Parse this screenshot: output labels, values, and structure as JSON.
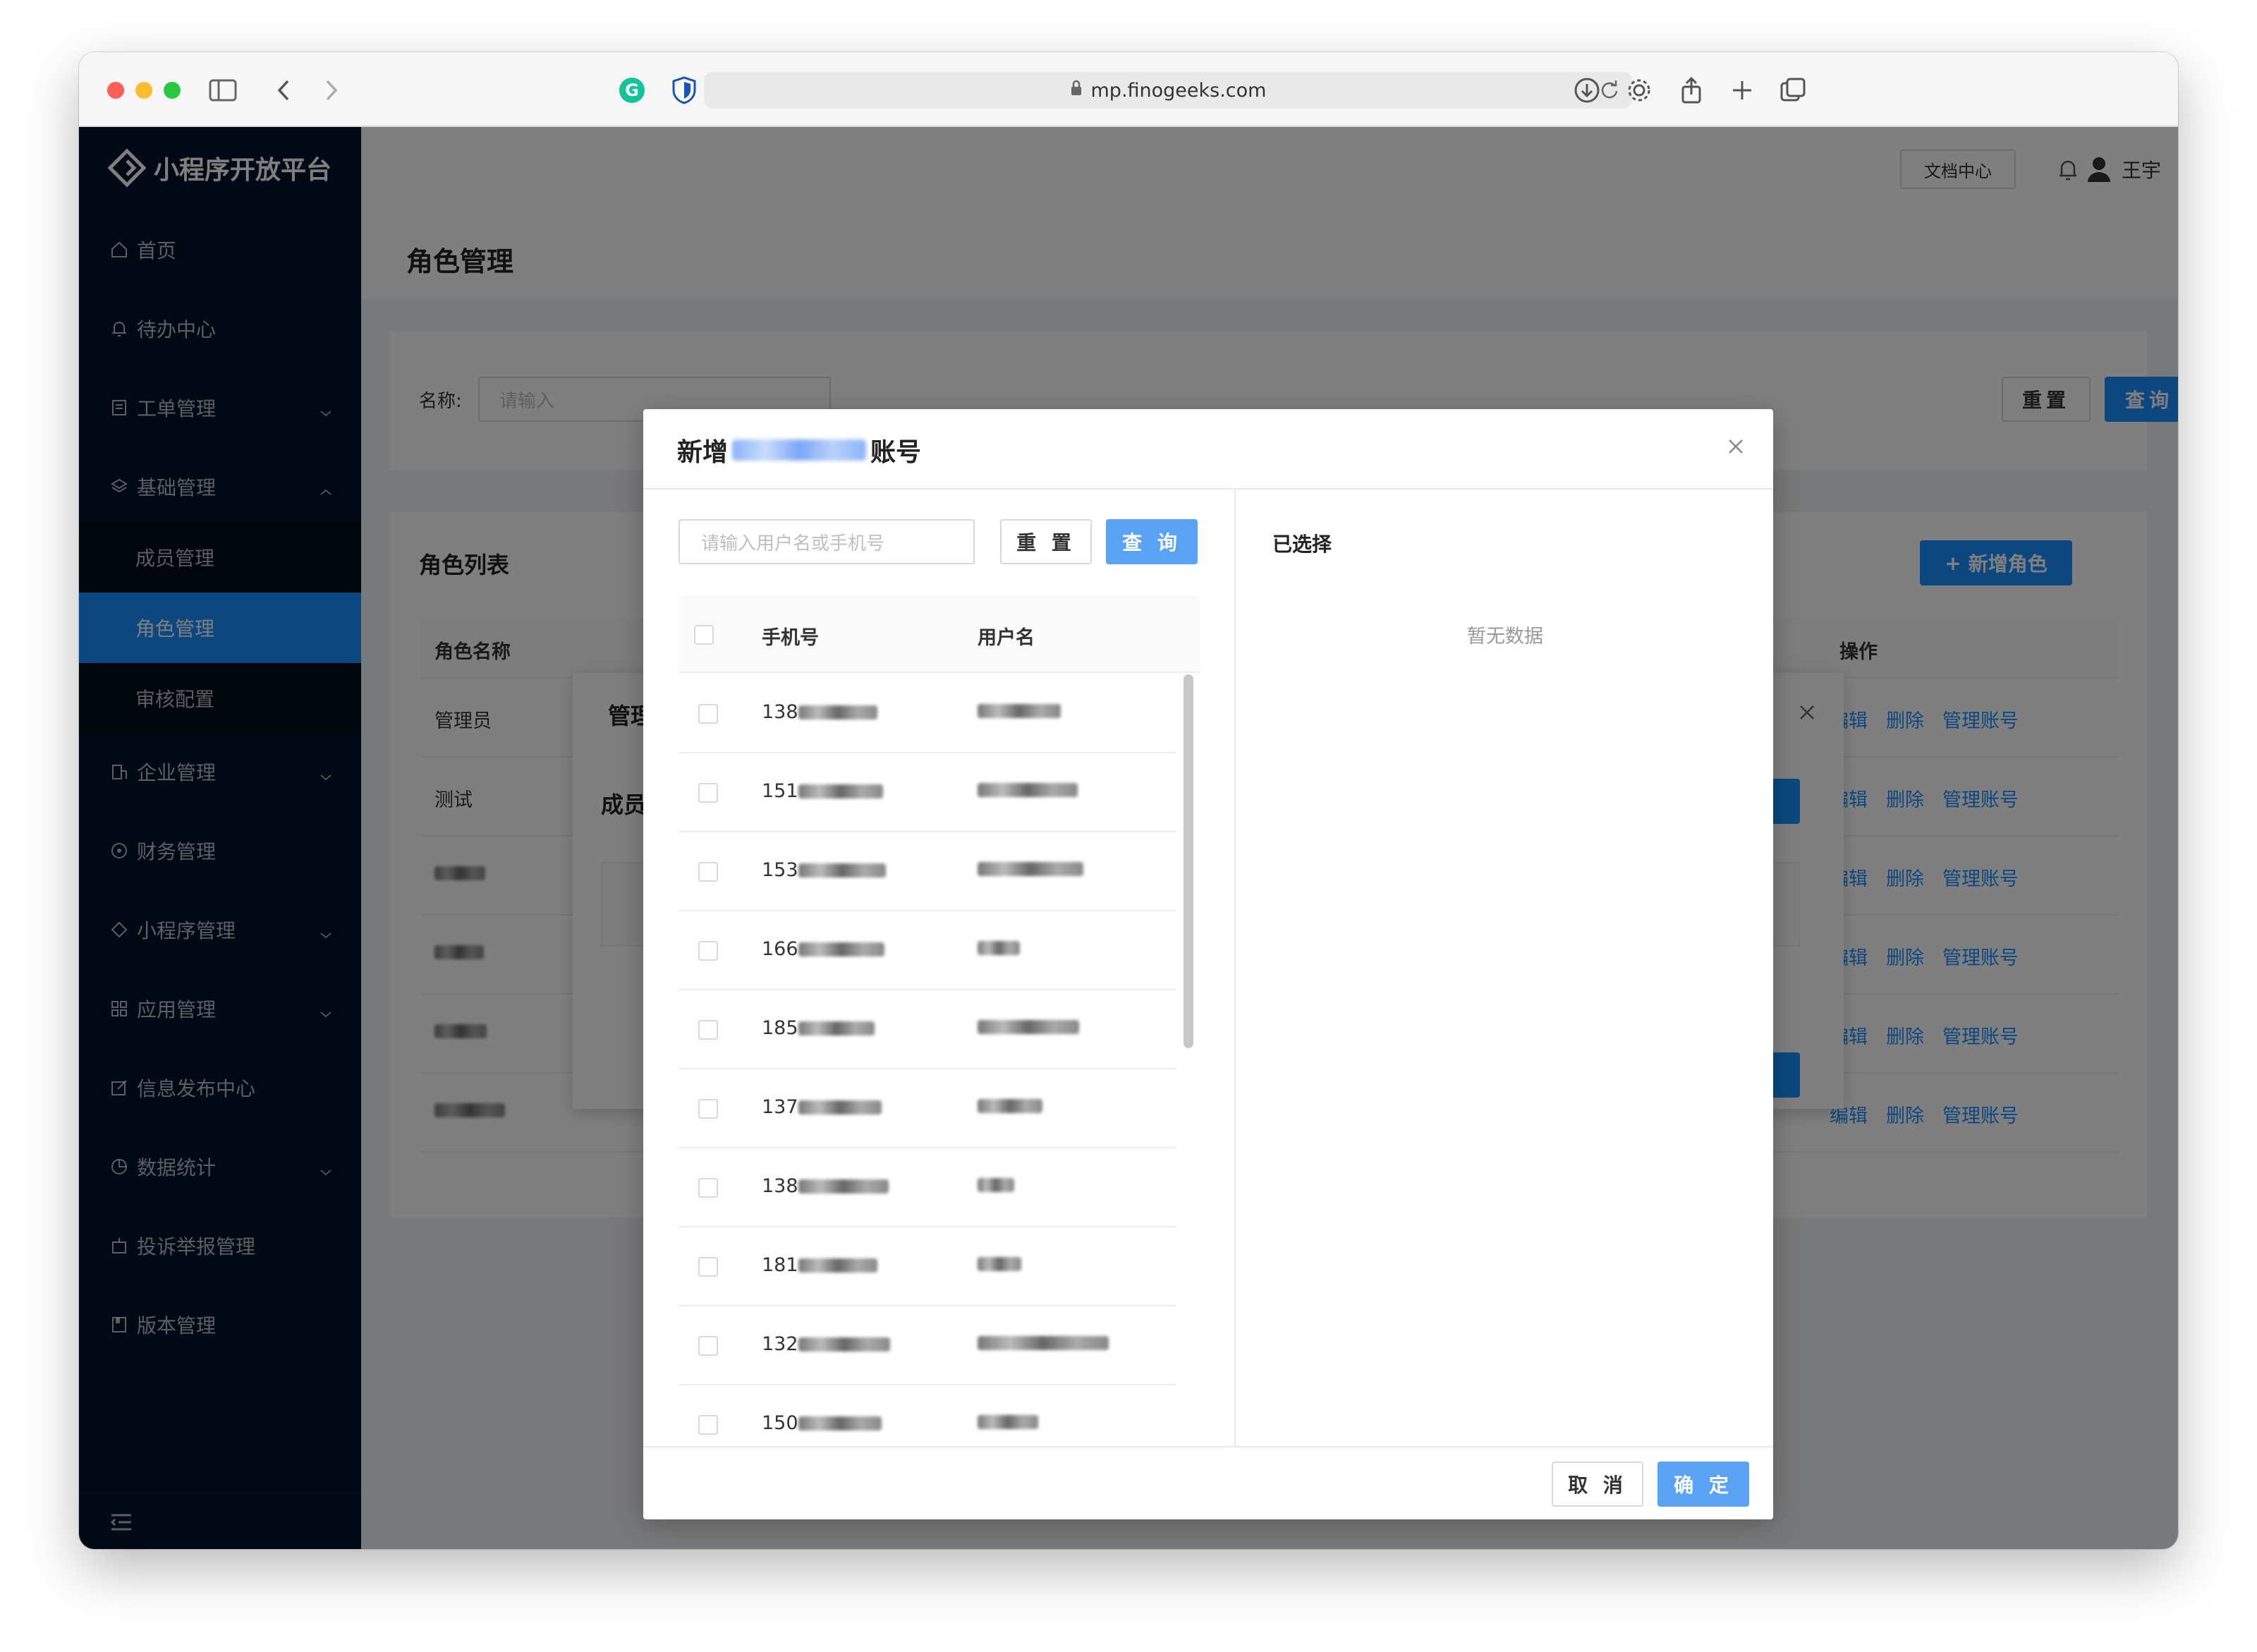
{
  "browser": {
    "url": "mp.finogeeks.com"
  },
  "sidebar": {
    "logo": "小程序开放平台",
    "items": [
      {
        "label": "首页",
        "icon": "home-icon"
      },
      {
        "label": "待办中心",
        "icon": "bell-icon"
      },
      {
        "label": "工单管理",
        "icon": "ticket-icon",
        "expandable": true
      },
      {
        "label": "基础管理",
        "icon": "layers-icon",
        "expanded": true
      },
      {
        "label": "成员管理",
        "sub": true
      },
      {
        "label": "角色管理",
        "sub": true,
        "active": true
      },
      {
        "label": "审核配置",
        "sub": true
      },
      {
        "label": "企业管理",
        "icon": "building-icon",
        "expandable": true
      },
      {
        "label": "财务管理",
        "icon": "finance-icon"
      },
      {
        "label": "小程序管理",
        "icon": "miniprogram-icon",
        "expandable": true
      },
      {
        "label": "应用管理",
        "icon": "apps-icon",
        "expandable": true
      },
      {
        "label": "信息发布中心",
        "icon": "edit-icon"
      },
      {
        "label": "数据统计",
        "icon": "pie-chart-icon",
        "expandable": true
      },
      {
        "label": "投诉举报管理",
        "icon": "report-icon"
      },
      {
        "label": "版本管理",
        "icon": "version-icon"
      }
    ]
  },
  "header": {
    "doc_center": "文档中心",
    "user_name": "王宇"
  },
  "page": {
    "title": "角色管理",
    "filter_label": "名称:",
    "filter_placeholder": "请输入",
    "reset": "重置",
    "query": "查询"
  },
  "role_list": {
    "title": "角色列表",
    "add_button": "新增角色",
    "col_name": "角色名称",
    "col_actions": "操作",
    "actions": [
      "编辑",
      "删除",
      "管理账号"
    ],
    "rows": [
      {
        "name": "管理员"
      },
      {
        "name": "测试"
      },
      {
        "name": ""
      },
      {
        "name": ""
      },
      {
        "name": ""
      },
      {
        "name": ""
      }
    ]
  },
  "bg_dialog": {
    "title": "管理",
    "section": "成员"
  },
  "modal": {
    "title_prefix": "新增",
    "title_suffix": "账号",
    "search_placeholder": "请输入用户名或手机号",
    "reset": "重 置",
    "query": "查 询",
    "col_phone": "手机号",
    "col_user": "用户名",
    "rows": [
      {
        "phone": "138"
      },
      {
        "phone": "151"
      },
      {
        "phone": "153"
      },
      {
        "phone": "166"
      },
      {
        "phone": "185"
      },
      {
        "phone": "137"
      },
      {
        "phone": "138"
      },
      {
        "phone": "181"
      },
      {
        "phone": "132"
      },
      {
        "phone": "150"
      }
    ],
    "selected_title": "已选择",
    "empty": "暂无数据",
    "cancel": "取 消",
    "ok": "确 定"
  },
  "colors": {
    "primary": "#1890ff",
    "sidebar_bg": "#001529"
  }
}
